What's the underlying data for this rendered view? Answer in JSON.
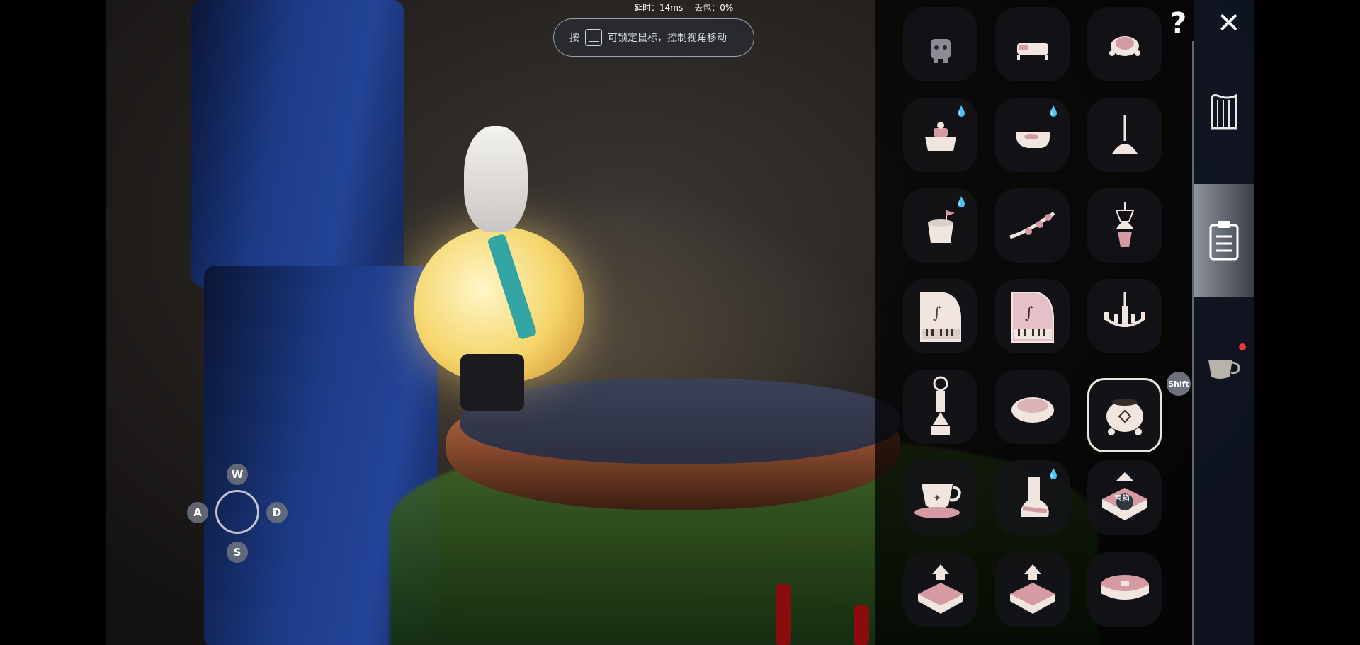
{
  "hud": {
    "latency_text": "延时：14ms",
    "loss_text": "丢包：0%"
  },
  "hint": {
    "press_text": "按",
    "key_icon": "keyboard-key-icon",
    "rest_text": "可锁定鼠标，控制视角移动"
  },
  "movement_keys": {
    "up": "W",
    "left": "A",
    "right": "D",
    "down": "S"
  },
  "top_buttons": {
    "help": "?",
    "close": "✕"
  },
  "props": {
    "items": [
      {
        "icon": "robot-figure-icon",
        "drop": false
      },
      {
        "icon": "bed-icon",
        "drop": false
      },
      {
        "icon": "turtle-icon",
        "drop": false
      },
      {
        "icon": "dining-table-icon",
        "drop": true
      },
      {
        "icon": "bathtub-icon",
        "drop": true
      },
      {
        "icon": "standing-lamp-icon",
        "drop": false
      },
      {
        "icon": "stump-with-flag-icon",
        "drop": true
      },
      {
        "icon": "blossom-branch-icon",
        "drop": false
      },
      {
        "icon": "hanging-planter-icon",
        "drop": false
      },
      {
        "icon": "white-grand-piano-icon",
        "drop": false
      },
      {
        "icon": "pink-grand-piano-icon",
        "drop": false
      },
      {
        "icon": "chandelier-icon",
        "drop": false
      },
      {
        "icon": "hourglass-candle-icon",
        "drop": false
      },
      {
        "icon": "cushion-icon",
        "drop": false
      },
      {
        "icon": "clay-pot-icon",
        "drop": false,
        "selected": true
      },
      {
        "icon": "teacup-icon",
        "drop": false
      },
      {
        "icon": "boot-icon",
        "drop": true
      },
      {
        "icon": "treasure-chest-icon",
        "drop": false,
        "label": "宝箱"
      },
      {
        "icon": "upgrade-platform-icon",
        "drop": false
      },
      {
        "icon": "upgrade-platform-icon",
        "drop": false
      },
      {
        "icon": "round-stool-icon",
        "drop": false
      }
    ]
  },
  "side_tabs": [
    {
      "icon": "harp-icon",
      "active": false
    },
    {
      "icon": "clipboard-icon",
      "active": true
    },
    {
      "icon": "teacup-icon",
      "active": false,
      "notification": true
    }
  ],
  "shift_badge": "Shift"
}
